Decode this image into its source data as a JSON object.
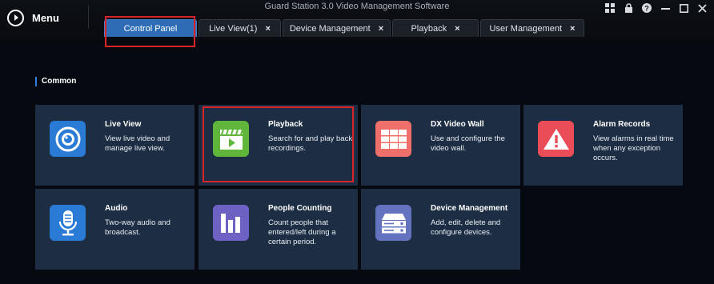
{
  "app": {
    "title": "Guard Station 3.0 Video Management Software"
  },
  "menu": {
    "label": "Menu"
  },
  "tabs": [
    {
      "label": "Control Panel",
      "closable": false,
      "active": true
    },
    {
      "label": "Live View(1)",
      "closable": true,
      "active": false
    },
    {
      "label": "Device Management",
      "closable": true,
      "active": false
    },
    {
      "label": "Playback",
      "closable": true,
      "active": false
    },
    {
      "label": "User Management",
      "closable": true,
      "active": false
    }
  ],
  "close_glyph": "×",
  "section": {
    "title": "Common"
  },
  "cards": [
    {
      "title": "Live View",
      "desc": "View live video and manage live view.",
      "icon": "camera-icon",
      "color": "#2a7bd6"
    },
    {
      "title": "Playback",
      "desc": "Search for and play back recordings.",
      "icon": "clapperboard-icon",
      "color": "#5fb63a"
    },
    {
      "title": "DX Video Wall",
      "desc": "Use and configure the video wall.",
      "icon": "video-wall-icon",
      "color": "#ef6f6a"
    },
    {
      "title": "Alarm Records",
      "desc": "View alarms in real time when any exception occurs.",
      "icon": "warning-icon",
      "color": "#ea4d57"
    },
    {
      "title": "Audio",
      "desc": "Two-way audio and broadcast.",
      "icon": "microphone-icon",
      "color": "#2a7bd6"
    },
    {
      "title": "People Counting",
      "desc": "Count people that entered/left during a certain period.",
      "icon": "bar-chart-icon",
      "color": "#6d62c4"
    },
    {
      "title": "Device Management",
      "desc": "Add, edit, delete and configure devices.",
      "icon": "device-icon",
      "color": "#6473c0"
    }
  ],
  "colors": {
    "active_tab": "#2e6db5",
    "card_bg": "#1d2e44",
    "highlight": "#d9252a"
  }
}
